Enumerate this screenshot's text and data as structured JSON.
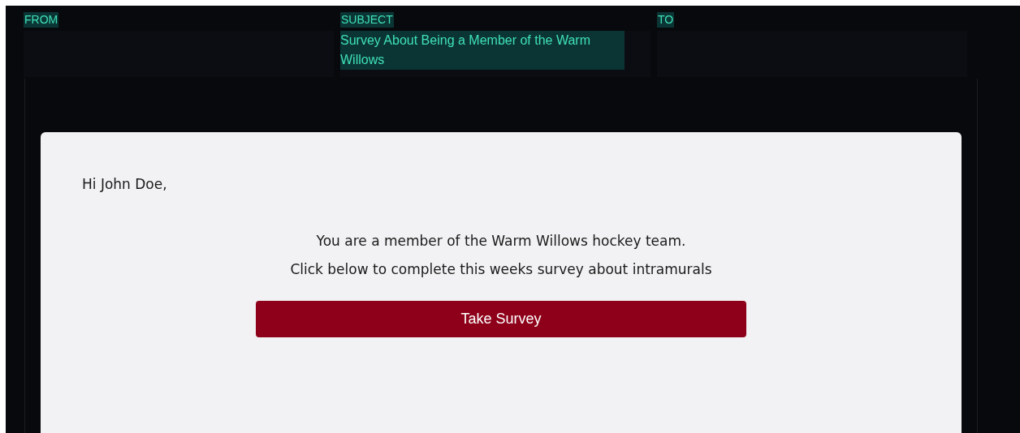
{
  "header": {
    "fields": [
      {
        "label": "FROM"
      },
      {
        "label": "SUBJECT",
        "value": "Survey About Being a Member of the Warm Willows"
      },
      {
        "label": "TO"
      }
    ]
  },
  "email": {
    "greeting": "Hi John Doe,",
    "lines": [
      "You are a member of the Warm Willows hockey team.",
      "Click below to complete this weeks survey about intramurals"
    ],
    "button": "Take Survey"
  }
}
